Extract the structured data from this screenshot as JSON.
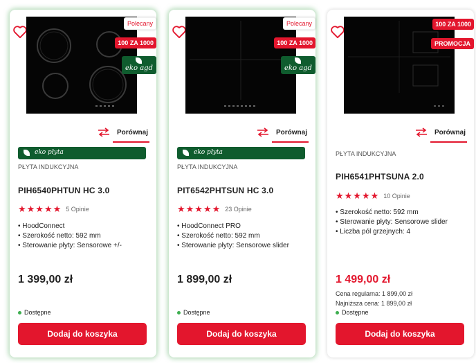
{
  "colors": {
    "accent": "#e3162d",
    "eco_green": "#0f5c2e",
    "available": "#3dae4f"
  },
  "products": [
    {
      "badge_recommended": "Polecany",
      "badge_promo": "100 ZA 1000",
      "eko_badge": "eko agd",
      "compare_label": "Porównaj",
      "eko_plyta": "eko płyta",
      "category": "PŁYTA INDUKCYJNA",
      "name": "PIH6540PHTUN HC 3.0",
      "stars": "★★★★★",
      "rating_value": 5,
      "reviews": "5 Opinie",
      "features": [
        "HoodConnect",
        "Szerokość netto: 592 mm",
        "Sterowanie płyty: Sensorowe +/-"
      ],
      "price": "1 399,00 zł",
      "availability": "Dostępne",
      "cart_label": "Dodaj do koszyka"
    },
    {
      "badge_recommended": "Polecany",
      "badge_promo": "100 ZA 1000",
      "eko_badge": "eko agd",
      "compare_label": "Porównaj",
      "eko_plyta": "eko płyta",
      "category": "PŁYTA INDUKCYJNA",
      "name": "PIT6542PHTSUN HC 3.0",
      "stars": "★★★★★",
      "rating_value": 5,
      "reviews": "23 Opinie",
      "features": [
        "HoodConnect PRO",
        "Szerokość netto: 592 mm",
        "Sterowanie płyty: Sensorowe slider"
      ],
      "price": "1 899,00 zł",
      "availability": "Dostępne",
      "cart_label": "Dodaj do koszyka"
    },
    {
      "badge_promo": "100 ZA 1000",
      "badge_promocja": "PROMOCJA",
      "compare_label": "Porównaj",
      "category": "PŁYTA INDUKCYJNA",
      "name": "PIH6541PHTSUNA 2.0",
      "stars": "★★★★★",
      "rating_value": 5,
      "reviews": "10 Opinie",
      "features": [
        "Szerokość netto: 592 mm",
        "Sterowanie płyty: Sensorowe slider",
        "Liczba pól grzejnych: 4"
      ],
      "price": "1 499,00 zł",
      "regular_price": "Cena regularna: 1 899,00 zł",
      "lowest_price": "Najniższa cena: 1 899,00 zł",
      "availability": "Dostępne",
      "cart_label": "Dodaj do koszyka"
    }
  ]
}
